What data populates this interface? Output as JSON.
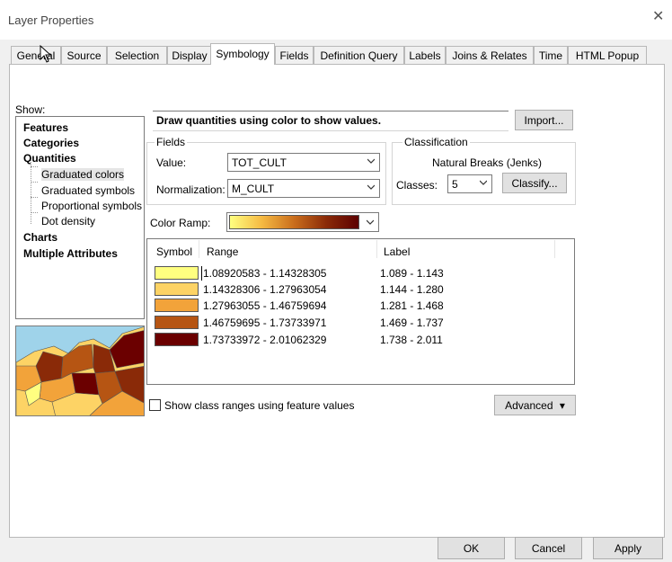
{
  "window": {
    "title": "Layer Properties",
    "close_glyph": "✕"
  },
  "tabs": [
    {
      "label": "General",
      "active": false
    },
    {
      "label": "Source",
      "active": false
    },
    {
      "label": "Selection",
      "active": false
    },
    {
      "label": "Display",
      "active": false
    },
    {
      "label": "Symbology",
      "active": true
    },
    {
      "label": "Fields",
      "active": false
    },
    {
      "label": "Definition Query",
      "active": false
    },
    {
      "label": "Labels",
      "active": false
    },
    {
      "label": "Joins & Relates",
      "active": false
    },
    {
      "label": "Time",
      "active": false
    },
    {
      "label": "HTML Popup",
      "active": false
    }
  ],
  "show": {
    "label": "Show:",
    "tree": {
      "features": "Features",
      "categories": "Categories",
      "quantities": "Quantities",
      "graduated_colors": "Graduated colors",
      "graduated_symbols": "Graduated symbols",
      "proportional_symbols": "Proportional symbols",
      "dot_density": "Dot density",
      "charts": "Charts",
      "multiple_attributes": "Multiple Attributes"
    }
  },
  "symbology": {
    "headline": "Draw quantities using color to show values.",
    "import_label": "Import...",
    "fields": {
      "title": "Fields",
      "value_label": "Value:",
      "value": "TOT_CULT",
      "normalization_label": "Normalization:",
      "normalization": "M_CULT"
    },
    "classification": {
      "title": "Classification",
      "method": "Natural Breaks (Jenks)",
      "classes_label": "Classes:",
      "classes": "5",
      "classify_label": "Classify..."
    },
    "color_ramp_label": "Color Ramp:",
    "color_ramp": [
      "#ffff80",
      "#f5b942",
      "#c96d1c",
      "#8a2a08",
      "#5c0000"
    ],
    "table": {
      "headers": {
        "symbol": "Symbol",
        "range": "Range",
        "label": "Label"
      },
      "rows": [
        {
          "color": "#ffff80",
          "range": "1.08920583 - 1.14328305",
          "label": "1.089 - 1.143"
        },
        {
          "color": "#fdd365",
          "range": "1.14328306 - 1.27963054",
          "label": "1.144 - 1.280"
        },
        {
          "color": "#f2a33a",
          "range": "1.27963055 - 1.46759694",
          "label": "1.281 - 1.468"
        },
        {
          "color": "#b65513",
          "range": "1.46759695 - 1.73733971",
          "label": "1.469 - 1.737"
        },
        {
          "color": "#6b0000",
          "range": "1.73733972 - 2.01062329",
          "label": "1.738 - 2.011"
        }
      ]
    },
    "show_ranges_label": "Show class ranges using feature values",
    "show_ranges_checked": false,
    "advanced_label": "Advanced",
    "advanced_arrow": "▾"
  },
  "footer": {
    "ok_label": "OK",
    "cancel_label": "Cancel",
    "apply_label": "Apply"
  }
}
